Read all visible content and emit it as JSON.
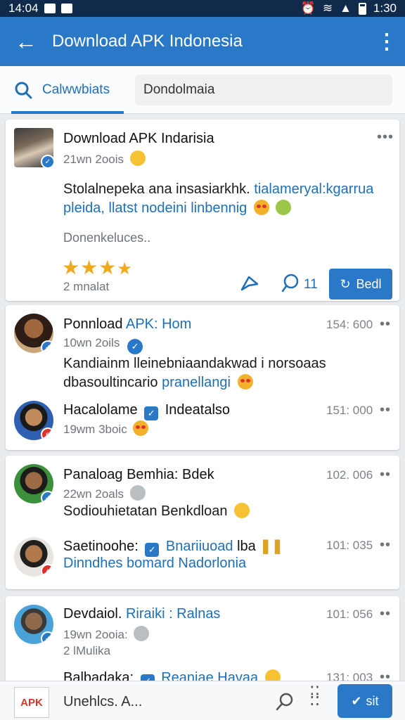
{
  "status_bar": {
    "time_left": "14:04",
    "time_right": "1:30"
  },
  "app_bar": {
    "title": "Download APK Indonesia"
  },
  "search": {
    "tab_label": "Calwwbiats",
    "field_value": "Dondolmaia"
  },
  "posts": [
    {
      "name": "Download APK Indarisia",
      "meta": "21wn 2oois",
      "line1_a": "Stolalnepeka ana insasiarkhk.",
      "line1_b": "tialameryal:kgarrua",
      "line2_a": "pleida,",
      "line2_b": "llatst nodeini linbennig",
      "subtitle": "Donenkeluces..",
      "rating": 3.5,
      "footer": "2 mnalat",
      "comment_count": "11",
      "action_label": "Bedl"
    },
    {
      "name_a": "Ponnload",
      "name_b": "APK: Hom",
      "meta": "10wn 2oils",
      "time": "154: 600",
      "line1": "Kandiainm lleinebniaandakwad i norsoaas",
      "line2_a": "dbasoultincario",
      "line2_b": "pranellangi"
    },
    {
      "name_a": "Hacalolame",
      "name_b": "Indeatalso",
      "meta": "19wm 3boic",
      "time": "151: 000"
    },
    {
      "name": "Panaloag Bemhia: Bdek",
      "meta": "22wn 2oals",
      "time": "102. 006",
      "line1": "Sodiouhietatan Benkdloan"
    },
    {
      "name_a": "Saetinoohe:",
      "name_b": "Bnariiuoad",
      "name_c": "lba",
      "time": "101: 035",
      "line1": "Dinndhes bomard Nadorlonia"
    },
    {
      "name_a": "Devdaiol.",
      "name_b": "Riraiki : Ralnas",
      "meta": "19wn 2ooia:",
      "time": "101: 056",
      "line1": "2 lMulika"
    },
    {
      "name_a": "Balbadaka:",
      "name_b": "Reaniae Havaa",
      "time": "131: 003"
    }
  ],
  "bottom_bar": {
    "thumb_label": "APK",
    "text": "Unehlcs. A...",
    "send_label": "sit"
  },
  "colors": {
    "primary": "#2a78c8",
    "status_bar": "#0f2a4a",
    "star": "#f0a81c"
  }
}
